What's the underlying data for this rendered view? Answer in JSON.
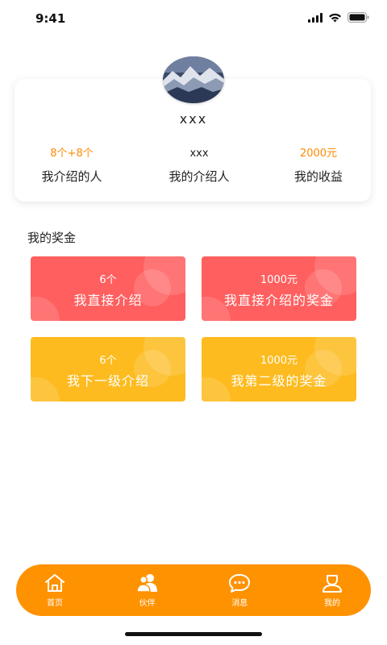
{
  "status_bar": {
    "time": "9:41"
  },
  "profile": {
    "username": "xxx",
    "stats": [
      {
        "value": "8个+8个",
        "label": "我介绍的人",
        "color": "#ff8a00"
      },
      {
        "value": "xxx",
        "label": "我的介绍人",
        "color": "#222222"
      },
      {
        "value": "2000元",
        "label": "我的收益",
        "color": "#ff8a00"
      }
    ]
  },
  "bonus": {
    "title": "我的奖金",
    "cards": [
      {
        "value": "6个",
        "label": "我直接介绍",
        "color": "#ff5f5f"
      },
      {
        "value": "1000元",
        "label": "我直接介绍的奖金",
        "color": "#ff5f5f"
      },
      {
        "value": "6个",
        "label": "我下一级介绍",
        "color": "#fdbb1f"
      },
      {
        "value": "1000元",
        "label": "我第二级的奖金",
        "color": "#fdbb1f"
      }
    ]
  },
  "tab_bar": {
    "color": "#ff9200",
    "items": [
      {
        "label": "首页",
        "icon": "home-icon"
      },
      {
        "label": "伙伴",
        "icon": "partners-icon"
      },
      {
        "label": "消息",
        "icon": "chat-bubble-icon"
      },
      {
        "label": "我的",
        "icon": "user-icon"
      }
    ]
  }
}
